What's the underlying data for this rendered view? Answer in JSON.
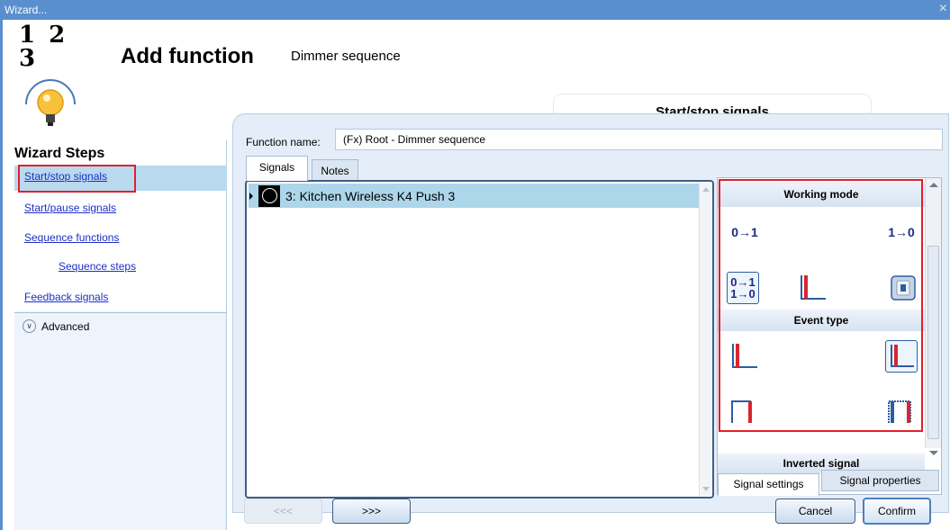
{
  "window": {
    "title": "Wizard...",
    "close_glyph": "×"
  },
  "header": {
    "logo_numbers": "1 2 3",
    "title": "Add function",
    "subtitle": "Dimmer sequence",
    "current_step": "Start/stop signals"
  },
  "sidebar": {
    "title": "Wizard Steps",
    "items": [
      {
        "label": "Start/stop signals",
        "selected": true
      },
      {
        "label": "Start/pause signals"
      },
      {
        "label": "Sequence functions"
      },
      {
        "label": "Sequence steps"
      },
      {
        "label": "Feedback signals"
      }
    ],
    "advanced_label": "Advanced"
  },
  "main": {
    "function_name_label": "Function name:",
    "function_name_value": "(Fx) Root - Dimmer sequence",
    "tabs": [
      {
        "label": "Signals",
        "active": true
      },
      {
        "label": "Notes"
      }
    ],
    "signals": [
      {
        "label": "3: Kitchen Wireless K4 Push 3"
      }
    ]
  },
  "settings_panel": {
    "working_mode_title": "Working mode",
    "working_mode_icons": {
      "rise": "0→1",
      "fall": "1→0",
      "both_top": "0→1",
      "both_bottom": "1→0"
    },
    "event_type_title": "Event type",
    "inverted_signal_title": "Inverted signal",
    "tabs": [
      {
        "label": "Signal settings",
        "active": true
      },
      {
        "label": "Signal properties"
      }
    ]
  },
  "footer": {
    "prev_label": "<<<",
    "next_label": ">>>",
    "cancel_label": "Cancel",
    "confirm_label": "Confirm"
  },
  "colors": {
    "titlebar": "#5a8fcf",
    "link": "#1d2fc6",
    "selected_row": "#add6ea",
    "highlight_box": "#e0202c",
    "pulse_red": "#d8262e",
    "pulse_blue": "#2b5ea3"
  }
}
